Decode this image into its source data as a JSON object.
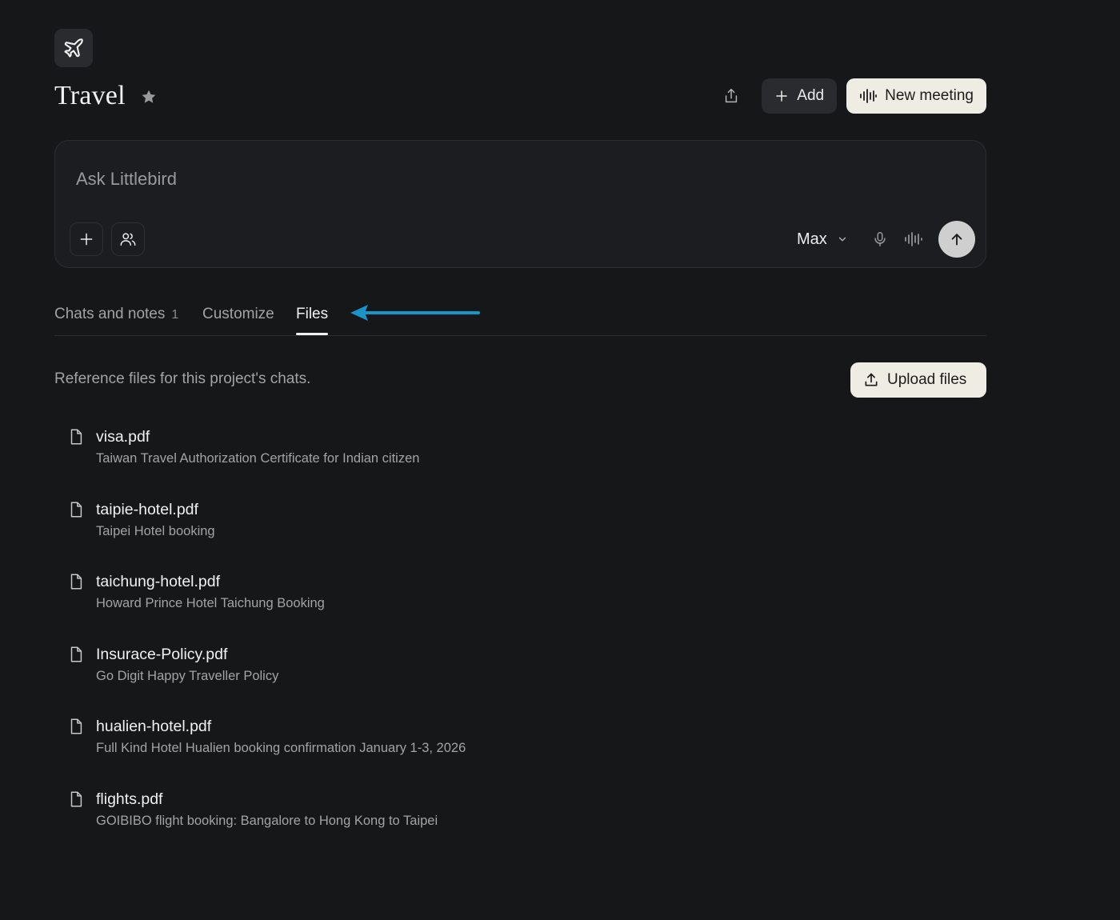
{
  "project": {
    "title": "Travel",
    "icon": "airplane-icon"
  },
  "header": {
    "add_label": "Add",
    "new_meeting_label": "New meeting"
  },
  "ask": {
    "placeholder": "Ask Littlebird",
    "model": "Max"
  },
  "tabs": [
    {
      "label": "Chats and notes",
      "count": "1",
      "active": false
    },
    {
      "label": "Customize",
      "active": false
    },
    {
      "label": "Files",
      "active": true
    }
  ],
  "files_section": {
    "description": "Reference files for this project's chats.",
    "upload_label": "Upload files"
  },
  "files": [
    {
      "name": "visa.pdf",
      "description": "Taiwan Travel Authorization Certificate for Indian citizen"
    },
    {
      "name": "taipie-hotel.pdf",
      "description": "Taipei Hotel booking"
    },
    {
      "name": "taichung-hotel.pdf",
      "description": "Howard Prince Hotel Taichung Booking"
    },
    {
      "name": "Insurace-Policy.pdf",
      "description": "Go Digit Happy Traveller Policy"
    },
    {
      "name": "hualien-hotel.pdf",
      "description": "Full Kind Hotel Hualien booking confirmation January 1-3, 2026"
    },
    {
      "name": "flights.pdf",
      "description": "GOIBIBO flight booking: Bangalore to Hong Kong to Taipei"
    }
  ],
  "colors": {
    "background": "#161719",
    "surface": "#1c1d20",
    "accent_light": "#efece3",
    "annotation_arrow": "#1a93c8"
  }
}
